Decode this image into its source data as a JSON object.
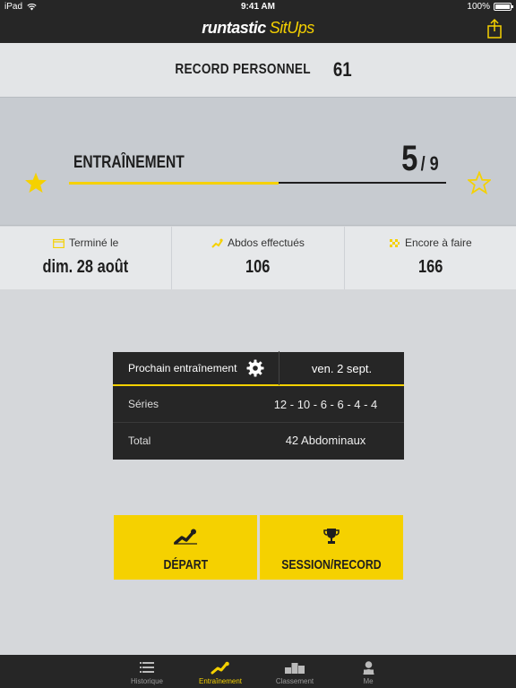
{
  "status_bar": {
    "device": "iPad",
    "time": "9:41 AM",
    "battery": "100%"
  },
  "header": {
    "brand": "runtastic",
    "product": "SitUps"
  },
  "record": {
    "label": "RECORD PERSONNEL",
    "value": "61"
  },
  "training": {
    "label": "ENTRAÎNEMENT",
    "current": "5",
    "total": "/ 9",
    "progress": 0.555
  },
  "stats": [
    {
      "label": "Terminé le",
      "value": "dim. 28 août"
    },
    {
      "label": "Abdos effectués",
      "value": "106"
    },
    {
      "label": "Encore à faire",
      "value": "166"
    }
  ],
  "next": {
    "title": "Prochain entraînement",
    "date": "ven. 2 sept.",
    "rows": [
      {
        "label": "Séries",
        "value": "12 - 10 - 6 - 6 - 4 - 4"
      },
      {
        "label": "Total",
        "value": "42 Abdominaux"
      }
    ]
  },
  "buttons": {
    "start": "DÉPART",
    "session": "SESSION/RECORD"
  },
  "tabs": [
    {
      "label": "Historique",
      "active": false
    },
    {
      "label": "Entraînement",
      "active": true
    },
    {
      "label": "Classement",
      "active": false
    },
    {
      "label": "Me",
      "active": false
    }
  ],
  "colors": {
    "accent": "#f5d100",
    "dark": "#262626",
    "background": "#d5d7da"
  }
}
